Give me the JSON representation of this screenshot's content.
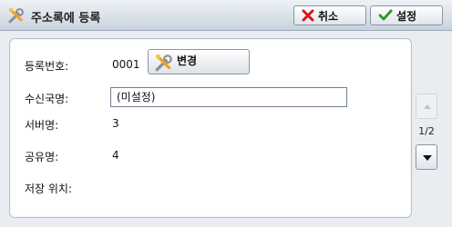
{
  "header": {
    "title": "주소록에 등록",
    "cancel_label": "취소",
    "set_label": "설정"
  },
  "form": {
    "reg_number_label": "등록번호:",
    "reg_number_value": "0001",
    "change_label": "변경",
    "receiver_label": "수신국명:",
    "receiver_value": "(미설정)",
    "server_label": "서버명:",
    "server_value": "3",
    "share_label": "공유명:",
    "share_value": "4",
    "location_label": "저장 위치:"
  },
  "pager": {
    "indicator": "1/2"
  },
  "colors": {
    "cancel_icon": "#d8161b",
    "set_icon": "#2f9a2a",
    "tool_icon": "#f0a020"
  }
}
